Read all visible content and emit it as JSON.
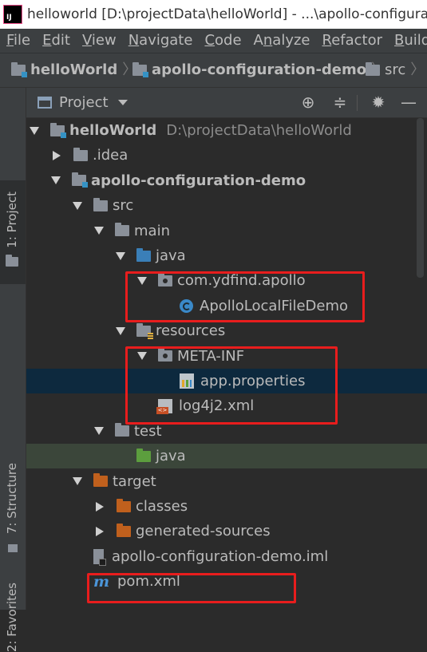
{
  "window": {
    "title": "helloworld [D:\\projectData\\helloWorld] - ...\\apollo-configuration-demo",
    "logo_text": "IJ"
  },
  "menu": [
    "File",
    "Edit",
    "View",
    "Navigate",
    "Code",
    "Analyze",
    "Refactor",
    "Build"
  ],
  "menu_mnemonic_index": [
    0,
    0,
    0,
    0,
    0,
    1,
    0,
    0
  ],
  "breadcrumb": [
    "helloWorld",
    "apollo-configuration-demo",
    "src"
  ],
  "side_tabs": {
    "project": "1: Project",
    "structure": "7: Structure",
    "favorites": "2: Favorites"
  },
  "panel": {
    "title": "Project",
    "icons": [
      "locate-icon",
      "collapse-icon",
      "gear-icon",
      "minimize-icon"
    ]
  },
  "tree": [
    {
      "label": "helloWorld",
      "path": "D:\\projectData\\helloWorld",
      "bold": true,
      "icon": "module-folder",
      "expand": "open",
      "level": 0
    },
    {
      "label": ".idea",
      "icon": "folder",
      "expand": "closed",
      "level": 1
    },
    {
      "label": "apollo-configuration-demo",
      "bold": true,
      "icon": "module-folder",
      "expand": "open",
      "level": 1
    },
    {
      "label": "src",
      "icon": "folder",
      "expand": "open",
      "level": 2
    },
    {
      "label": "main",
      "icon": "folder",
      "expand": "open",
      "level": 3
    },
    {
      "label": "java",
      "icon": "source-folder",
      "expand": "open",
      "level": 4
    },
    {
      "label": "com.ydfind.apollo",
      "icon": "package-folder",
      "expand": "open",
      "level": 5
    },
    {
      "label": "ApolloLocalFileDemo",
      "icon": "class-file",
      "expand": "none",
      "level": 6
    },
    {
      "label": "resources",
      "icon": "resources-folder",
      "expand": "open",
      "level": 4
    },
    {
      "label": "META-INF",
      "icon": "package-folder",
      "expand": "open",
      "level": 5
    },
    {
      "label": "app.properties",
      "icon": "properties-file",
      "expand": "none",
      "level": 6,
      "selected": true
    },
    {
      "label": "log4j2.xml",
      "icon": "xml-file",
      "expand": "none",
      "level": 5
    },
    {
      "label": "test",
      "icon": "folder",
      "expand": "open",
      "level": 3
    },
    {
      "label": "java",
      "icon": "test-folder",
      "expand": "none",
      "level": 4,
      "test": true
    },
    {
      "label": "target",
      "icon": "excluded-folder",
      "expand": "open",
      "level": 2
    },
    {
      "label": "classes",
      "icon": "excluded-folder",
      "expand": "closed",
      "level": 3
    },
    {
      "label": "generated-sources",
      "icon": "excluded-folder",
      "expand": "closed",
      "level": 3
    },
    {
      "label": "apollo-configuration-demo.iml",
      "icon": "iml-file",
      "expand": "none",
      "level": 2
    },
    {
      "label": "pom.xml",
      "icon": "maven-file",
      "expand": "none",
      "level": 2
    }
  ],
  "colors": {
    "selection": "#0d293e",
    "highlight_box": "#e81d1d",
    "test_row": "#3b463a"
  }
}
